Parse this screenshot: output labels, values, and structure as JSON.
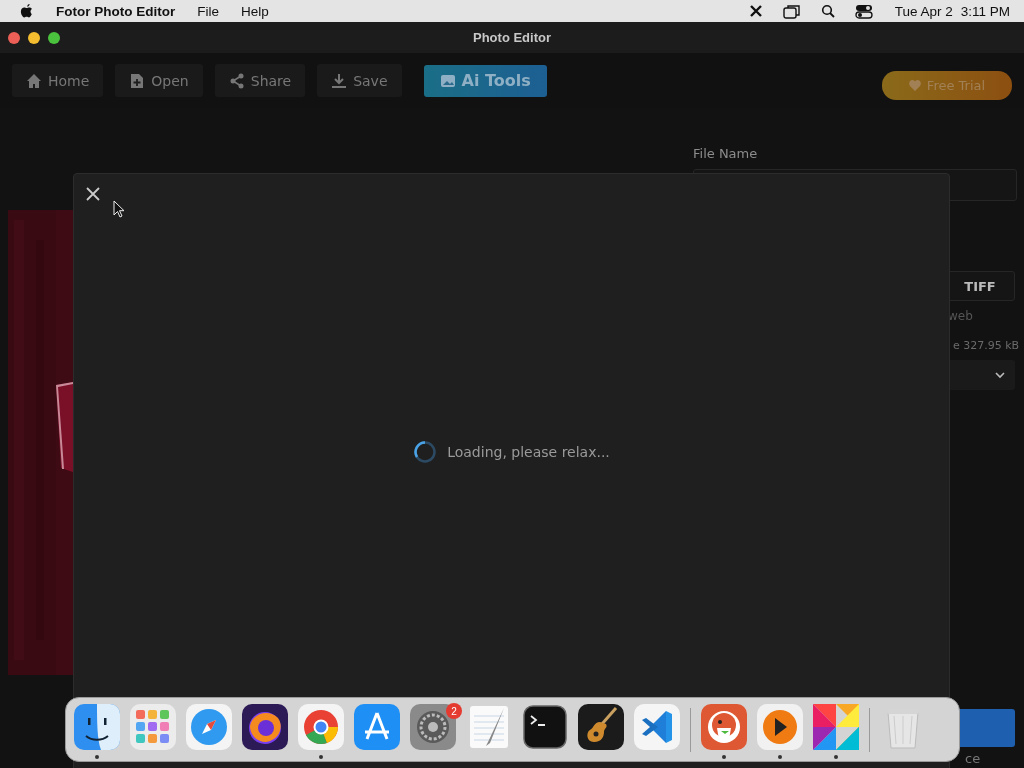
{
  "menubar": {
    "app_name": "Fotor Photo Editor",
    "menus": [
      "File",
      "Help"
    ],
    "date": "Tue Apr 2",
    "time": "3:11 PM"
  },
  "window": {
    "title": "Photo Editor"
  },
  "toolbar": {
    "buttons": [
      {
        "label": "Home",
        "kind": "home"
      },
      {
        "label": "Open",
        "kind": "open"
      },
      {
        "label": "Share",
        "kind": "share"
      },
      {
        "label": "Save",
        "kind": "save"
      },
      {
        "label": "Ai Tools",
        "kind": "ai"
      }
    ],
    "trial_button": "Free Trial"
  },
  "side_panel": {
    "file_name_label": "File Name",
    "format_button": "TIFF",
    "note": "web",
    "size": "e 327.95 kB",
    "footer": "ce"
  },
  "modal": {
    "loading_text": "Loading, please relax..."
  },
  "dock": {
    "sections": [
      {
        "items": [
          {
            "kind": "finder",
            "running": true
          },
          {
            "kind": "launchpad",
            "running": false
          },
          {
            "kind": "safari",
            "running": false
          },
          {
            "kind": "firefox",
            "running": false
          },
          {
            "kind": "chrome",
            "running": true
          },
          {
            "kind": "appstore",
            "running": false
          },
          {
            "kind": "settings",
            "running": false,
            "badge": "2"
          },
          {
            "kind": "textedit",
            "running": false
          },
          {
            "kind": "terminal",
            "running": false
          },
          {
            "kind": "guitar",
            "running": false
          },
          {
            "kind": "code",
            "running": false
          }
        ]
      },
      {
        "items": [
          {
            "kind": "duck",
            "running": true
          },
          {
            "kind": "player",
            "running": true
          },
          {
            "kind": "photos",
            "running": true
          }
        ]
      },
      {
        "items": [
          {
            "kind": "trash",
            "running": false
          }
        ]
      }
    ]
  }
}
